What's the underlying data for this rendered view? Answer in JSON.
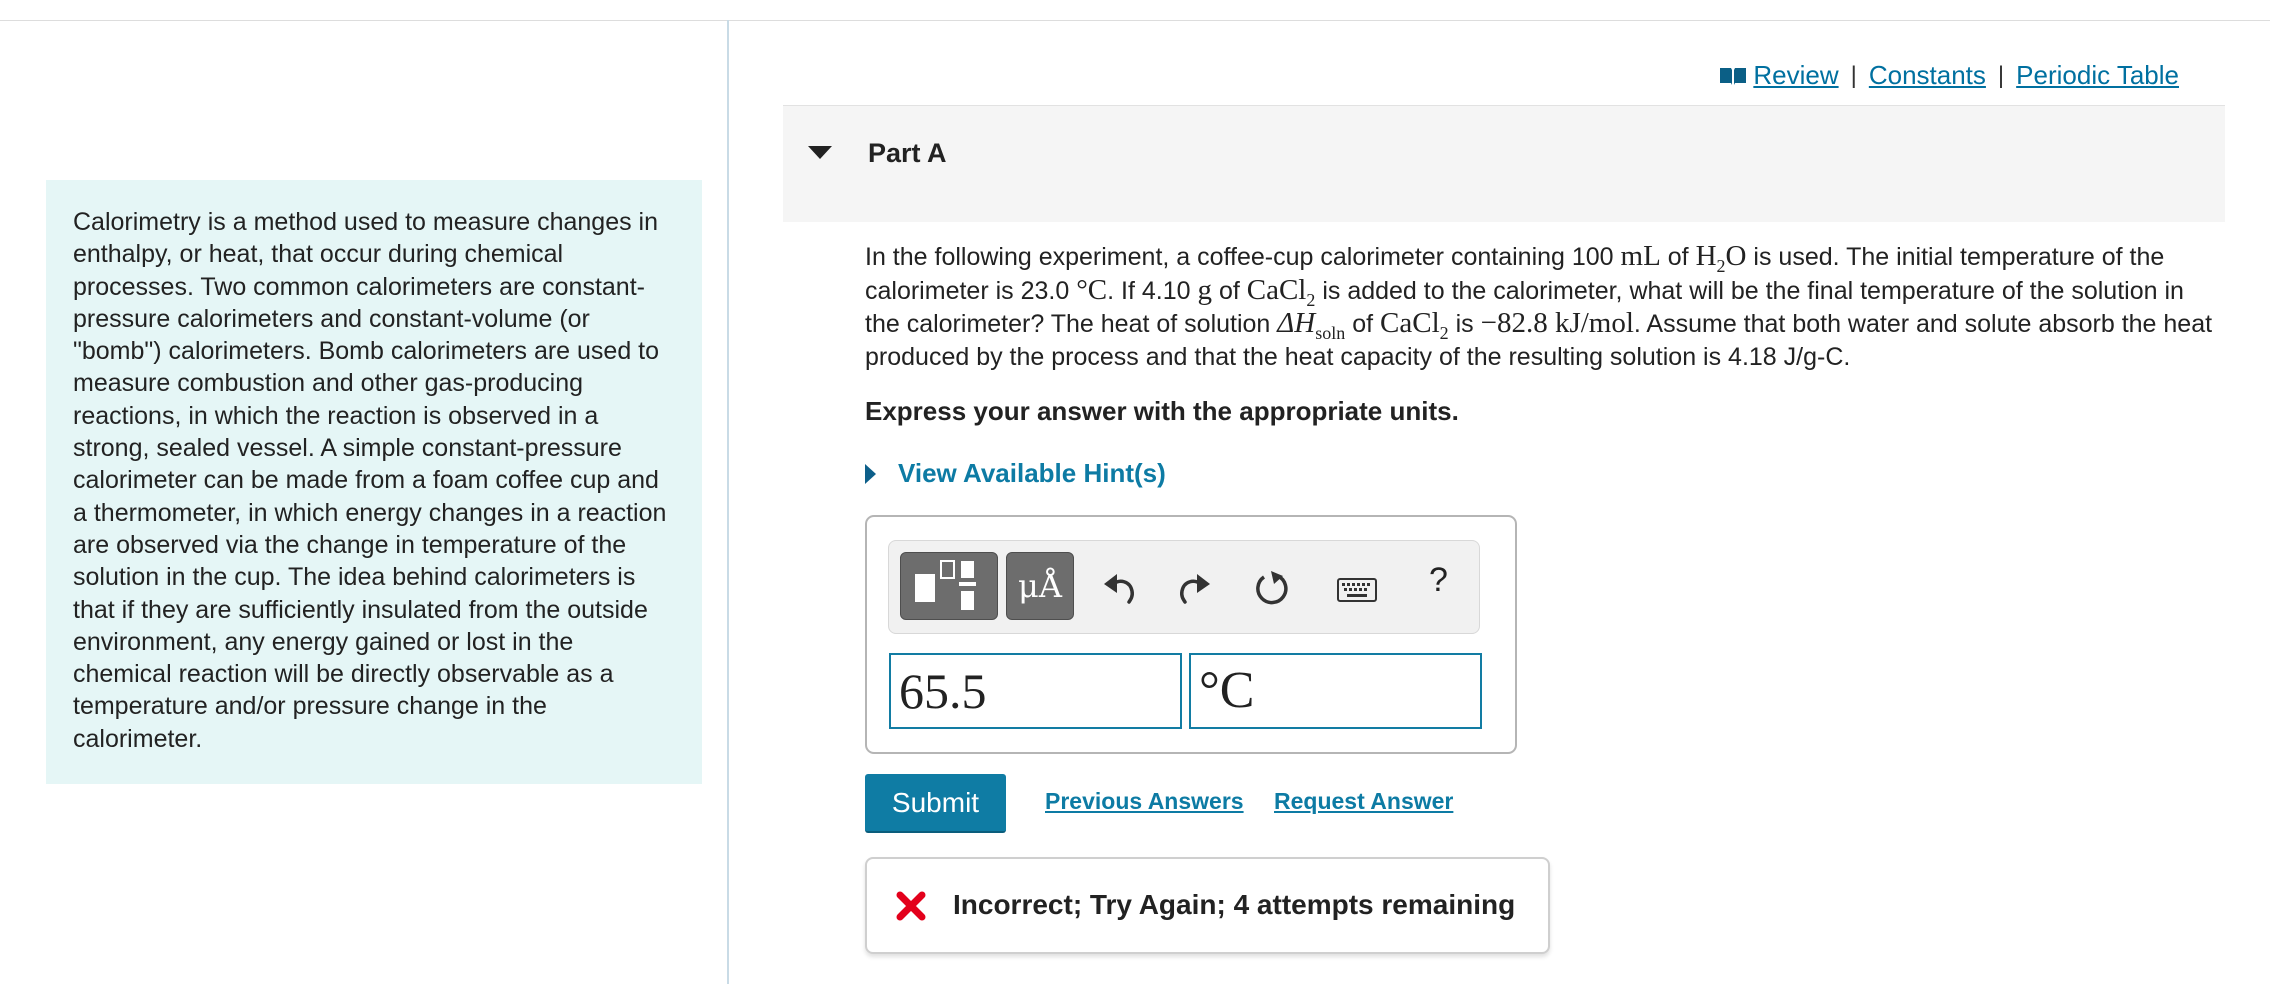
{
  "intro": {
    "text": "Calorimetry is a method used to measure changes in enthalpy, or heat, that occur during chemical processes. Two common calorimeters are constant-pressure calorimeters and constant-volume (or \"bomb\") calorimeters. Bomb calorimeters are used to measure combustion and other gas-producing reactions, in which the reaction is observed in a strong, sealed vessel. A simple constant-pressure calorimeter can be made from a foam coffee cup and a thermometer, in which energy changes in a reaction are observed via the change in temperature of the solution in the cup. The idea behind calorimeters is that if they are sufficiently insulated from the outside environment, any energy gained or lost in the chemical reaction will be directly observable as a temperature and/or pressure change in the calorimeter."
  },
  "resource_links": {
    "review": "Review",
    "constants": "Constants",
    "periodic_table": "Periodic Table",
    "separator": "|"
  },
  "part": {
    "title": "Part A"
  },
  "question": {
    "s1": "In the following experiment, a coffee-cup calorimeter containing 100 ",
    "m1": "mL",
    "s2": " of ",
    "m2a": "H",
    "m2sub": "2",
    "m2b": "O",
    "s3": " is used. The initial temperature of the calorimeter is 23.0 ",
    "m3": "°C",
    "s4": ". If 4.10 ",
    "m4": "g",
    "s5": " of ",
    "m5a": "CaCl",
    "m5sub": "2",
    "s6": " is added to the calorimeter, what will be the final temperature of the solution in the calorimeter? The heat of solution ",
    "m6a": "ΔH",
    "m6sub": "soln",
    "s7": " of ",
    "m7a": "CaCl",
    "m7sub": "2",
    "s8": " is ",
    "m8": "−82.8 kJ/mol",
    "s9": ". Assume that both water and solute absorb the heat produced by the process and that the heat capacity of the resulting solution is 4.18 J/g-C."
  },
  "express": "Express your answer with the appropriate units.",
  "hint": {
    "label": "View Available Hint(s)"
  },
  "toolbar": {
    "units_label": "μÅ",
    "help_label": "?",
    "icons": [
      "templates-icon",
      "units-icon",
      "undo-icon",
      "redo-icon",
      "reset-icon",
      "keyboard-icon",
      "help-icon"
    ]
  },
  "answer": {
    "value": "65.5",
    "unit": "°C"
  },
  "actions": {
    "submit": "Submit",
    "previous_answers": "Previous Answers",
    "request_answer": "Request Answer"
  },
  "feedback": {
    "text": "Incorrect; Try Again; 4 attempts remaining"
  },
  "colors": {
    "accent": "#0f7ca4",
    "link": "#0070a0",
    "intro_bg": "#e5f6f6",
    "error": "#e3001b"
  }
}
